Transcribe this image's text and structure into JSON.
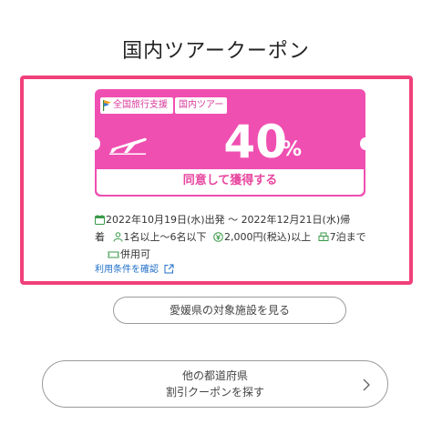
{
  "page": {
    "title": "国内ツアークーポン"
  },
  "coupon": {
    "tag_national": "全国旅行支援",
    "tag_domestic": "国内ツアー",
    "discount_value": "40",
    "discount_unit": "%",
    "cta_label": "同意して獲得する",
    "accent_color": "#ef4fb1"
  },
  "details": {
    "period_line1": "2022年10月19日(水)出発 〜 2022年12月21日(水)帰",
    "period_line2": "着",
    "people": "1名以上〜6名以下",
    "price": "2,000円(税込)以上",
    "nights": "7泊まで",
    "combination": "併用可"
  },
  "terms_link": "利用条件を確認",
  "facility_button": "愛媛県の対象施設を見る",
  "other_prefecture": {
    "line1": "他の都道府県",
    "line2": "割引クーポンを探す"
  },
  "icons": {
    "flag": "flag-icon",
    "plane": "plane-icon",
    "calendar": "calendar-icon",
    "person": "person-icon",
    "yen": "yen-icon",
    "bed": "bed-icon",
    "ticket": "ticket-icon",
    "external": "external-link-icon",
    "chevron": "chevron-right-icon"
  }
}
